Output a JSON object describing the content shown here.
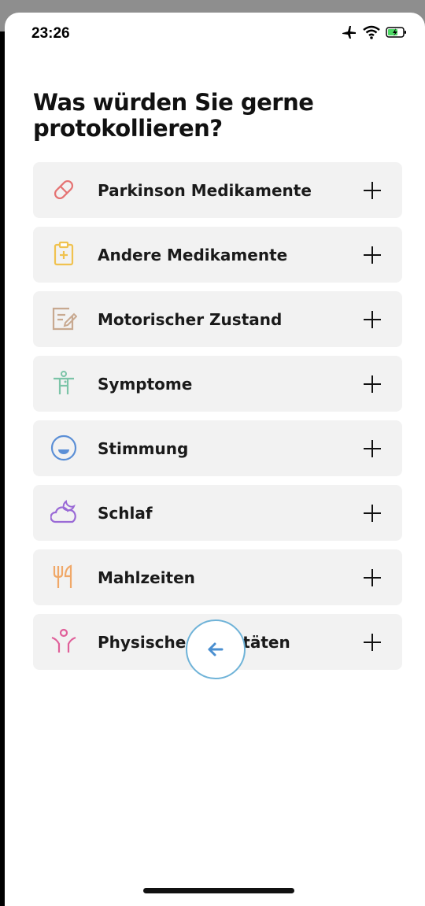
{
  "status": {
    "time": "23:26"
  },
  "title": "Was würden Sie gerne protokollieren?",
  "items": [
    {
      "label": "Parkinson Medikamente",
      "icon": "pill-icon",
      "color": "#e57373"
    },
    {
      "label": "Andere Medikamente",
      "icon": "clipboard-plus-icon",
      "color": "#f0c24f"
    },
    {
      "label": "Motorischer Zustand",
      "icon": "edit-note-icon",
      "color": "#c8a990"
    },
    {
      "label": "Symptome",
      "icon": "person-icon",
      "color": "#7cc4a8"
    },
    {
      "label": "Stimmung",
      "icon": "mood-icon",
      "color": "#5b8fd6"
    },
    {
      "label": "Schlaf",
      "icon": "moon-cloud-icon",
      "color": "#9a6ad6"
    },
    {
      "label": "Mahlzeiten",
      "icon": "fork-knife-icon",
      "color": "#f0a868"
    },
    {
      "label": "Physische Aktivitäten",
      "icon": "activity-icon",
      "color": "#e0609a"
    }
  ],
  "back_button": {
    "icon": "arrow-left-icon"
  }
}
